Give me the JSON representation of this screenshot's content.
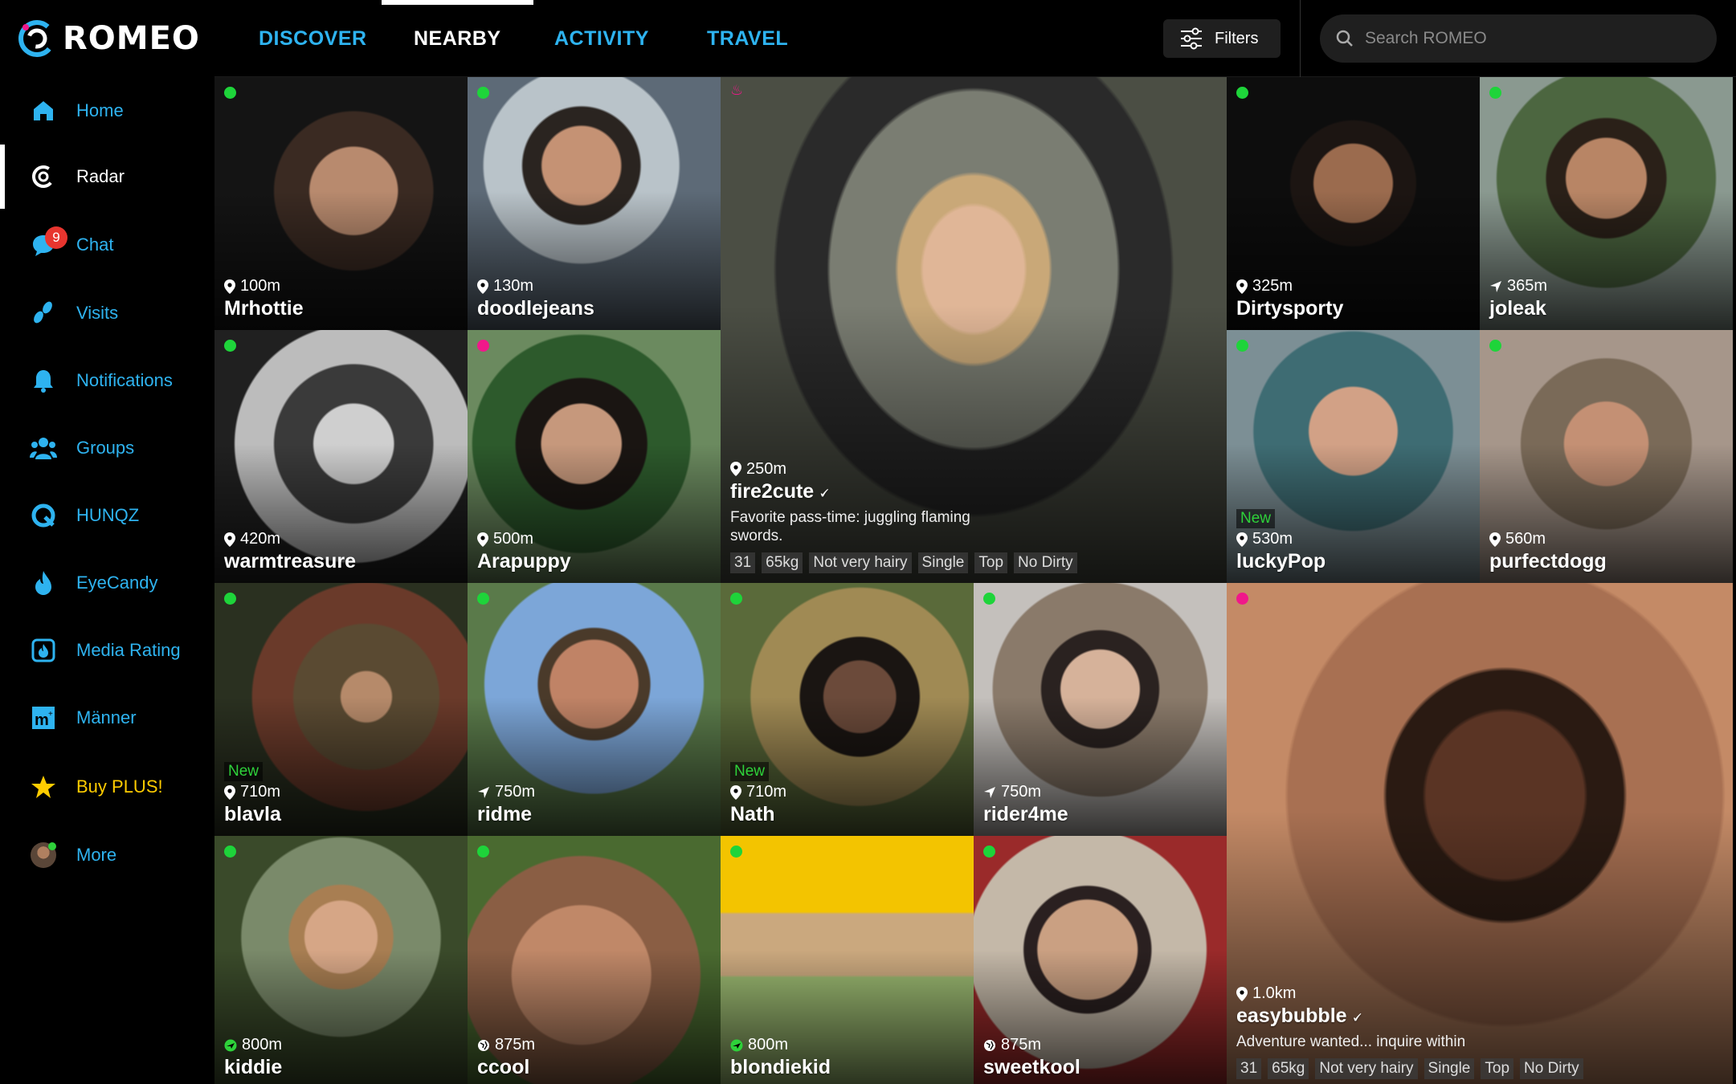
{
  "app": {
    "name": "ROMEO"
  },
  "nav": [
    {
      "label": "Home",
      "icon": "home-icon"
    },
    {
      "label": "Radar",
      "icon": "radar-icon",
      "active": true
    },
    {
      "label": "Chat",
      "icon": "chat-icon",
      "badge": "9"
    },
    {
      "label": "Visits",
      "icon": "footprints-icon"
    },
    {
      "label": "Notifications",
      "icon": "bell-icon"
    },
    {
      "label": "Groups",
      "icon": "groups-icon"
    },
    {
      "label": "HUNQZ",
      "icon": "hunqz-icon"
    },
    {
      "label": "EyeCandy",
      "icon": "eyecandy-icon"
    },
    {
      "label": "Media Rating",
      "icon": "media-rating-icon"
    },
    {
      "label": "Männer",
      "icon": "maenner-icon"
    },
    {
      "label": "Buy PLUS!",
      "icon": "star-icon"
    },
    {
      "label": "More",
      "icon": "avatar-icon"
    }
  ],
  "tabs": [
    {
      "label": "DISCOVER"
    },
    {
      "label": "NEARBY",
      "active": true
    },
    {
      "label": "ACTIVITY"
    },
    {
      "label": "TRAVEL"
    }
  ],
  "filters": {
    "label": "Filters"
  },
  "search": {
    "placeholder": "Search ROMEO"
  },
  "colors": {
    "accent": "#2eb3f0",
    "online": "#1ed43a",
    "pink": "#f0188a",
    "plus": "#ffcc00",
    "badge": "#e8352f"
  },
  "cards": [
    {
      "name": "Mrhottie",
      "distance": "100m",
      "dist_icon": "pin-icon",
      "status": "green"
    },
    {
      "name": "doodlejeans",
      "distance": "130m",
      "dist_icon": "pin-icon",
      "status": "green"
    },
    {
      "name": "fire2cute",
      "distance": "250m",
      "dist_icon": "pin-icon",
      "status": "flame",
      "verified": true,
      "bio": "Favorite pass-time: juggling flaming swords.",
      "tags": [
        "31",
        "65kg",
        "Not very hairy",
        "Single",
        "Top",
        "No Dirty"
      ]
    },
    {
      "name": "Dirtysporty",
      "distance": "325m",
      "dist_icon": "pin-icon",
      "status": "green"
    },
    {
      "name": "joleak",
      "distance": "365m",
      "dist_icon": "arrow-icon",
      "status": "green"
    },
    {
      "name": "warmtreasure",
      "distance": "420m",
      "dist_icon": "pin-icon",
      "status": "green"
    },
    {
      "name": "Arapuppy",
      "distance": "500m",
      "dist_icon": "pin-icon",
      "status": "pink"
    },
    {
      "name": "luckyPop",
      "distance": "530m",
      "dist_icon": "pin-icon",
      "status": "green",
      "new": "New"
    },
    {
      "name": "purfectdogg",
      "distance": "560m",
      "dist_icon": "pin-icon",
      "status": "green"
    },
    {
      "name": "blavla",
      "distance": "710m",
      "dist_icon": "pin-icon",
      "status": "green",
      "new": "New"
    },
    {
      "name": "ridme",
      "distance": "750m",
      "dist_icon": "arrow-icon",
      "status": "green"
    },
    {
      "name": "Nath",
      "distance": "710m",
      "dist_icon": "pin-icon",
      "status": "green",
      "new": "New"
    },
    {
      "name": "rider4me",
      "distance": "750m",
      "dist_icon": "arrow-icon",
      "status": "green"
    },
    {
      "name": "easybubble",
      "distance": "1.0km",
      "dist_icon": "pin-icon",
      "status": "pink",
      "verified": true,
      "bio": "Adventure wanted... inquire within",
      "tags": [
        "31",
        "65kg",
        "Not very hairy",
        "Single",
        "Top",
        "No Dirty"
      ]
    },
    {
      "name": "kiddie",
      "distance": "800m",
      "dist_icon": "plane-icon",
      "status": "green"
    },
    {
      "name": "ccool",
      "distance": "875m",
      "dist_icon": "globe-icon",
      "status": "green"
    },
    {
      "name": "blondiekid",
      "distance": "800m",
      "dist_icon": "plane-icon",
      "status": "green"
    },
    {
      "name": "sweetkool",
      "distance": "875m",
      "dist_icon": "globe-icon",
      "status": "green"
    }
  ]
}
